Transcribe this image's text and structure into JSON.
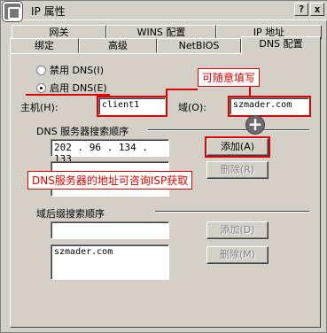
{
  "title": "IP 属性",
  "title_buttons": {
    "help": "?",
    "close": "x"
  },
  "tabs_row1": [
    "网关",
    "WINS 配置",
    "IP 地址"
  ],
  "tabs_row2": [
    "绑定",
    "高级",
    "NetBIOS",
    "DNS 配置"
  ],
  "dns": {
    "disable_label": "禁用 DNS(I)",
    "enable_label": "启用 DNS(E)",
    "host_label": "主机(H):",
    "host_value": "client1",
    "domain_label": "域(O):",
    "domain_value": "szmader.com",
    "search_order_label": "DNS 服务器搜索顺序",
    "server_input": "202 . 96 . 134 . 133",
    "add_label": "添加(A)",
    "delete_label": "删除(R)",
    "suffix_label": "域后缀搜索顺序",
    "suffix_add_label": "添加(D)",
    "suffix_delete_label": "删除(M)",
    "suffix_item": "szmader.com"
  },
  "annotations": {
    "note_fill": "可随意填写",
    "note_isp": "DNS服务器的地址可咨询ISP获取"
  },
  "colors": {
    "annotation": "#e00000",
    "dialog": "#d4d0c8"
  }
}
